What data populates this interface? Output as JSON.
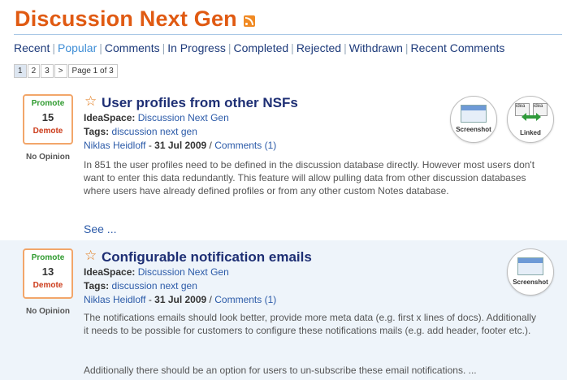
{
  "header": {
    "title": "Discussion Next Gen",
    "rss_icon": "rss-icon"
  },
  "nav": {
    "items": [
      "Recent",
      "Popular",
      "Comments",
      "In Progress",
      "Completed",
      "Rejected",
      "Withdrawn",
      "Recent Comments"
    ],
    "active": "Popular"
  },
  "pager": {
    "pages": [
      "1",
      "2",
      "3",
      ">"
    ],
    "current": "1",
    "info": "Page 1 of 3"
  },
  "labels": {
    "promote": "Promote",
    "demote": "Demote",
    "opinion": "No Opinion",
    "ideaspace": "IdeaSpace:",
    "tags": "Tags:",
    "sep": " - ",
    "see": "See ...",
    "screenshot": "Screenshot",
    "linked": "Linked",
    "idea_tag": "idea"
  },
  "ideas": [
    {
      "title": "User profiles from other NSFs",
      "votes": "15",
      "ideaspace": "Discussion Next Gen",
      "tags": "discussion next gen",
      "author": "Niklas Heidloff",
      "date": "31 Jul 2009",
      "comments": "Comments (1)",
      "description": "In 851 the user profiles need to be defined in the discussion database directly. However most users don't want to enter this data redundantly. This feature will allow pulling data from other discussion databases where users have already defined profiles or from any other custom Notes database."
    },
    {
      "title": "Configurable notification emails",
      "votes": "13",
      "ideaspace": "Discussion Next Gen",
      "tags": "discussion next gen",
      "author": "Niklas Heidloff",
      "date": "31 Jul 2009",
      "comments": "Comments (1)",
      "description": "The notifications emails should look better, provide more meta data (e.g. first x lines of docs). Additionally it needs to be possible for customers to configure these notifications mails (e.g. add header, footer etc.).",
      "description2": "Additionally there should be an option for users to un-subscribe these email notifications. ..."
    }
  ],
  "colors": {
    "title": "#e05a12",
    "promote": "#2e9a2e",
    "demote": "#cc3b1a",
    "link": "#2b5aa8",
    "heading": "#1e2f74"
  }
}
